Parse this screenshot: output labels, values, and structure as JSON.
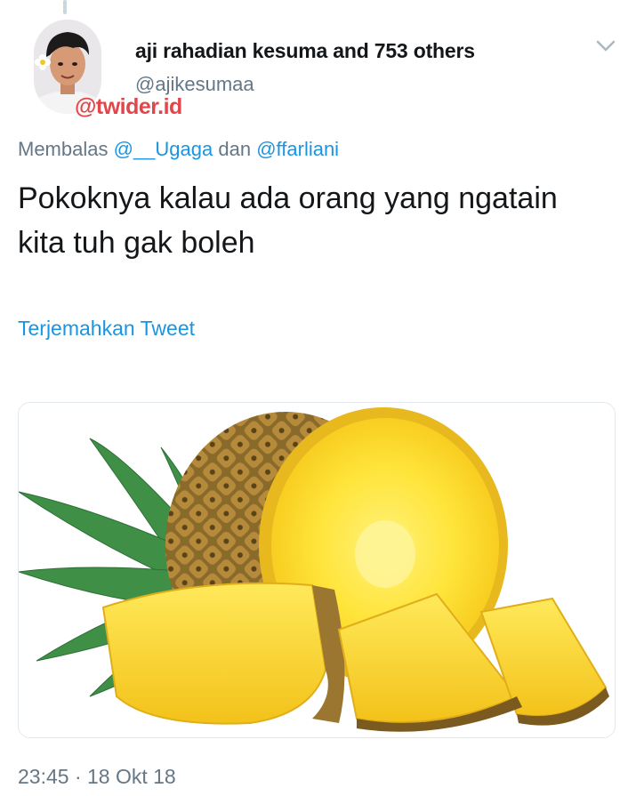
{
  "tweet": {
    "author_name": "aji rahadian kesuma and 753 others",
    "handle": "@ajikesumaa",
    "watermark": "@twider.id",
    "reply_prefix": "Membalas",
    "reply_mention_1": "@__Ugaga",
    "reply_joiner": "dan",
    "reply_mention_2": "@ffarliani",
    "text": "Pokoknya kalau ada orang yang ngatain kita tuh gak boleh",
    "translate_label": "Terjemahkan Tweet",
    "timestamp": "23:45 · 18 Okt 18"
  },
  "icons": {
    "menu": "chevron-down-icon",
    "avatar": "avatar",
    "media": "pineapple-image"
  },
  "colors": {
    "link": "#1b95e0",
    "secondary_text": "#657786",
    "primary_text": "#14171a",
    "watermark": "#e2464a"
  }
}
